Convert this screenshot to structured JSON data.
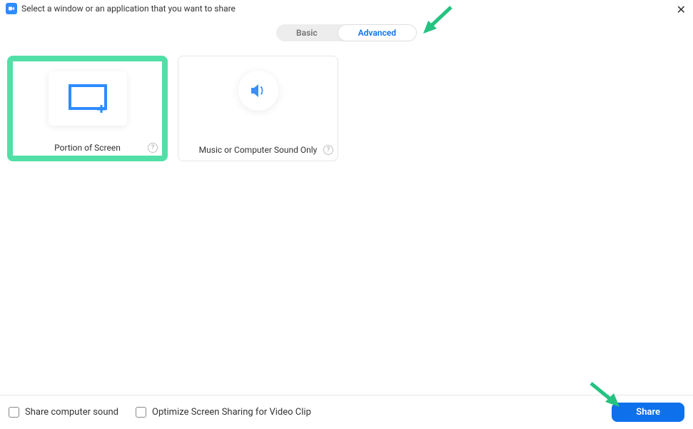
{
  "header": {
    "title": "Select a window or an application that you want to share"
  },
  "tabs": {
    "basic": "Basic",
    "advanced": "Advanced"
  },
  "options": {
    "portion_label": "Portion of Screen",
    "sound_label": "Music or Computer Sound Only"
  },
  "footer": {
    "share_sound_label": "Share computer sound",
    "optimize_label": "Optimize Screen Sharing for Video Clip",
    "share_button": "Share"
  },
  "colors": {
    "accent": "#0e71eb",
    "highlight": "#52dfa7"
  }
}
